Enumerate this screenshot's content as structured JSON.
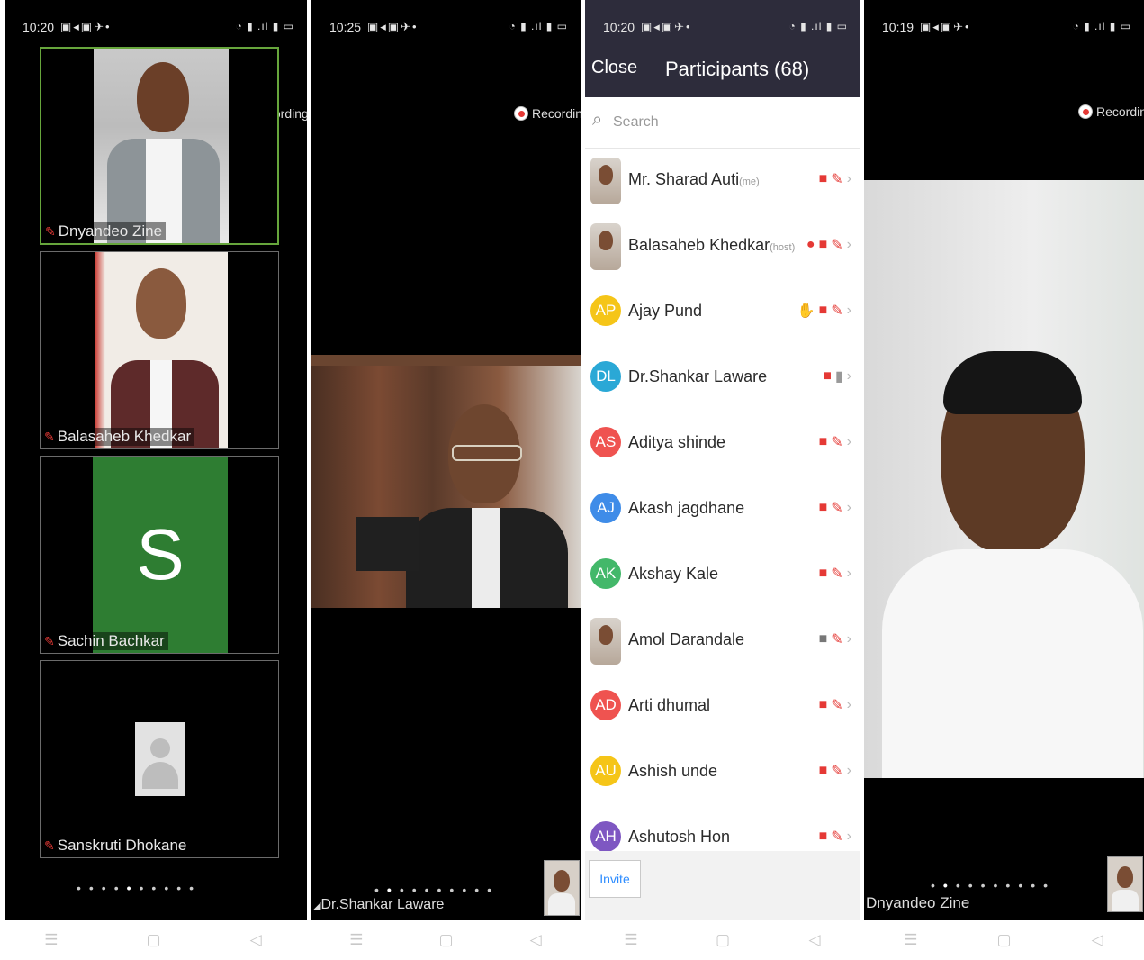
{
  "screens": [
    {
      "time": "10:20",
      "recording_label": "Recording",
      "tiles": [
        {
          "name": "Dnyandeo Zine",
          "active": true
        },
        {
          "name": "Balasaheb Khedkar"
        },
        {
          "name": "Sachin Bachkar",
          "initial": "S"
        },
        {
          "name": "Sanskruti Dhokane"
        }
      ]
    },
    {
      "time": "10:25",
      "recording_label": "Recording",
      "speaker_name": "Dr.Shankar Laware"
    },
    {
      "time": "10:20",
      "close_label": "Close",
      "title": "Participants (68)",
      "search_placeholder": "Search",
      "invite_label": "Invite",
      "participants": [
        {
          "name": "Mr. Sharad Auti",
          "tag": "(me)",
          "avatar_type": "photo"
        },
        {
          "name": "Balasaheb Khedkar",
          "tag": "(host)",
          "avatar_type": "photo",
          "recording": true
        },
        {
          "name": "Ajay Pund",
          "initials": "AP",
          "color": "#f5c518",
          "raised_hand": true
        },
        {
          "name": "Dr.Shankar Laware",
          "initials": "DL",
          "color": "#2aa8d6",
          "mic_on": true
        },
        {
          "name": "Aditya shinde",
          "initials": "AS",
          "color": "#ef5350"
        },
        {
          "name": "Akash jagdhane",
          "initials": "AJ",
          "color": "#3f8ce8"
        },
        {
          "name": "Akshay Kale",
          "initials": "AK",
          "color": "#43b86a"
        },
        {
          "name": "Amol Darandale",
          "avatar_type": "photo",
          "video_on": true
        },
        {
          "name": "Arti dhumal",
          "initials": "AD",
          "color": "#ef5350"
        },
        {
          "name": "Ashish unde",
          "initials": "AU",
          "color": "#f5c518"
        },
        {
          "name": "Ashutosh Hon",
          "initials": "AH",
          "color": "#7e57c2"
        }
      ]
    },
    {
      "time": "10:19",
      "recording_label": "Recording",
      "speaker_name": "Dnyandeo Zine"
    }
  ],
  "nav_icons": [
    "menu-icon",
    "home-icon",
    "back-icon"
  ]
}
